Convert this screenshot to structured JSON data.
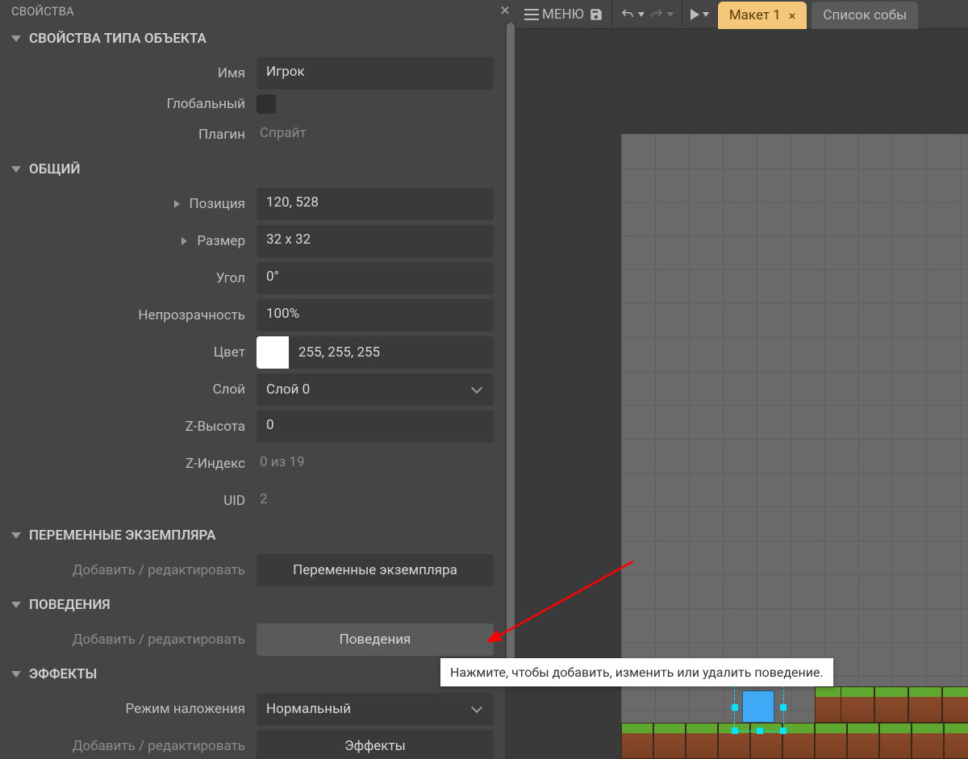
{
  "panel": {
    "title": "СВОЙСТВА",
    "sections": {
      "object_type": {
        "title": "СВОЙСТВА ТИПА ОБЪЕКТА",
        "name_label": "Имя",
        "name_value": "Игрок",
        "global_label": "Глобальный",
        "plugin_label": "Плагин",
        "plugin_value": "Спрайт"
      },
      "common": {
        "title": "ОБЩИЙ",
        "position_label": "Позиция",
        "position_value": "120,  528",
        "size_label": "Размер",
        "size_value": "32 x 32",
        "angle_label": "Угол",
        "angle_value": "0°",
        "opacity_label": "Непрозрачность",
        "opacity_value": "100%",
        "color_label": "Цвет",
        "color_value": "255, 255, 255",
        "layer_label": "Слой",
        "layer_value": "Слой 0",
        "zelev_label": "Z-Высота",
        "zelev_value": "0",
        "zindex_label": "Z-Индекс",
        "zindex_value": "0 из 19",
        "uid_label": "UID",
        "uid_value": "2"
      },
      "instance_vars": {
        "title": "ПЕРЕМЕННЫЕ ЭКЗЕМПЛЯРА",
        "addedit_label": "Добавить / редактировать",
        "button_label": "Переменные экземпляра"
      },
      "behaviors": {
        "title": "ПОВЕДЕНИЯ",
        "addedit_label": "Добавить / редактировать",
        "button_label": "Поведения"
      },
      "effects": {
        "title": "ЭФФЕКТЫ",
        "blend_label": "Режим наложения",
        "blend_value": "Нормальный",
        "addedit_label": "Добавить / редактировать",
        "button_label": "Эффекты"
      }
    }
  },
  "toolbar": {
    "menu_label": "МЕНЮ"
  },
  "tabs": {
    "active": "Макет 1",
    "inactive": "Список собы"
  },
  "tooltip": "Нажмите, чтобы добавить, изменить или удалить поведение."
}
